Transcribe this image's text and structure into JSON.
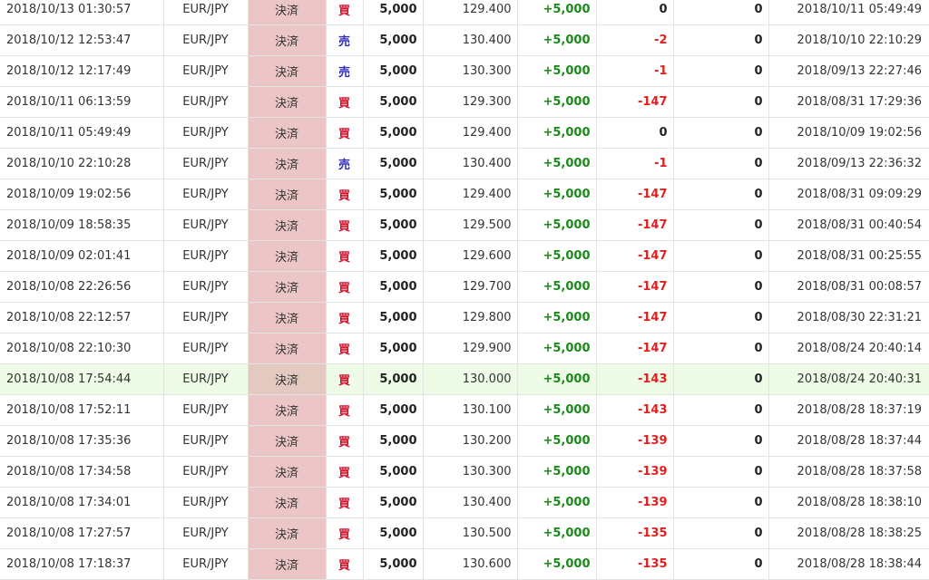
{
  "colors": {
    "type_cell_bg": "#ecc6c6",
    "highlight_row_bg": "#eefbe6",
    "positive": "#1a8a1a",
    "negative": "#e0201e",
    "buy": "#d0142c",
    "sell": "#2a2ab8"
  },
  "highlighted_row_index": 12,
  "rows": [
    {
      "close_time": "2018/10/13 01:30:57",
      "pair": "EUR/JPY",
      "type": "決済",
      "side": "買",
      "lots": "5,000",
      "rate": "129.400",
      "pnl": "+5,000",
      "swap": "0",
      "fee": "0",
      "open_time": "2018/10/11 05:49:49"
    },
    {
      "close_time": "2018/10/12 12:53:47",
      "pair": "EUR/JPY",
      "type": "決済",
      "side": "売",
      "lots": "5,000",
      "rate": "130.400",
      "pnl": "+5,000",
      "swap": "-2",
      "fee": "0",
      "open_time": "2018/10/10 22:10:29"
    },
    {
      "close_time": "2018/10/12 12:17:49",
      "pair": "EUR/JPY",
      "type": "決済",
      "side": "売",
      "lots": "5,000",
      "rate": "130.300",
      "pnl": "+5,000",
      "swap": "-1",
      "fee": "0",
      "open_time": "2018/09/13 22:27:46"
    },
    {
      "close_time": "2018/10/11 06:13:59",
      "pair": "EUR/JPY",
      "type": "決済",
      "side": "買",
      "lots": "5,000",
      "rate": "129.300",
      "pnl": "+5,000",
      "swap": "-147",
      "fee": "0",
      "open_time": "2018/08/31 17:29:36"
    },
    {
      "close_time": "2018/10/11 05:49:49",
      "pair": "EUR/JPY",
      "type": "決済",
      "side": "買",
      "lots": "5,000",
      "rate": "129.400",
      "pnl": "+5,000",
      "swap": "0",
      "fee": "0",
      "open_time": "2018/10/09 19:02:56"
    },
    {
      "close_time": "2018/10/10 22:10:28",
      "pair": "EUR/JPY",
      "type": "決済",
      "side": "売",
      "lots": "5,000",
      "rate": "130.400",
      "pnl": "+5,000",
      "swap": "-1",
      "fee": "0",
      "open_time": "2018/09/13 22:36:32"
    },
    {
      "close_time": "2018/10/09 19:02:56",
      "pair": "EUR/JPY",
      "type": "決済",
      "side": "買",
      "lots": "5,000",
      "rate": "129.400",
      "pnl": "+5,000",
      "swap": "-147",
      "fee": "0",
      "open_time": "2018/08/31 09:09:29"
    },
    {
      "close_time": "2018/10/09 18:58:35",
      "pair": "EUR/JPY",
      "type": "決済",
      "side": "買",
      "lots": "5,000",
      "rate": "129.500",
      "pnl": "+5,000",
      "swap": "-147",
      "fee": "0",
      "open_time": "2018/08/31 00:40:54"
    },
    {
      "close_time": "2018/10/09 02:01:41",
      "pair": "EUR/JPY",
      "type": "決済",
      "side": "買",
      "lots": "5,000",
      "rate": "129.600",
      "pnl": "+5,000",
      "swap": "-147",
      "fee": "0",
      "open_time": "2018/08/31 00:25:55"
    },
    {
      "close_time": "2018/10/08 22:26:56",
      "pair": "EUR/JPY",
      "type": "決済",
      "side": "買",
      "lots": "5,000",
      "rate": "129.700",
      "pnl": "+5,000",
      "swap": "-147",
      "fee": "0",
      "open_time": "2018/08/31 00:08:57"
    },
    {
      "close_time": "2018/10/08 22:12:57",
      "pair": "EUR/JPY",
      "type": "決済",
      "side": "買",
      "lots": "5,000",
      "rate": "129.800",
      "pnl": "+5,000",
      "swap": "-147",
      "fee": "0",
      "open_time": "2018/08/30 22:31:21"
    },
    {
      "close_time": "2018/10/08 22:10:30",
      "pair": "EUR/JPY",
      "type": "決済",
      "side": "買",
      "lots": "5,000",
      "rate": "129.900",
      "pnl": "+5,000",
      "swap": "-147",
      "fee": "0",
      "open_time": "2018/08/24 20:40:14"
    },
    {
      "close_time": "2018/10/08 17:54:44",
      "pair": "EUR/JPY",
      "type": "決済",
      "side": "買",
      "lots": "5,000",
      "rate": "130.000",
      "pnl": "+5,000",
      "swap": "-143",
      "fee": "0",
      "open_time": "2018/08/24 20:40:31"
    },
    {
      "close_time": "2018/10/08 17:52:11",
      "pair": "EUR/JPY",
      "type": "決済",
      "side": "買",
      "lots": "5,000",
      "rate": "130.100",
      "pnl": "+5,000",
      "swap": "-143",
      "fee": "0",
      "open_time": "2018/08/28 18:37:19"
    },
    {
      "close_time": "2018/10/08 17:35:36",
      "pair": "EUR/JPY",
      "type": "決済",
      "side": "買",
      "lots": "5,000",
      "rate": "130.200",
      "pnl": "+5,000",
      "swap": "-139",
      "fee": "0",
      "open_time": "2018/08/28 18:37:44"
    },
    {
      "close_time": "2018/10/08 17:34:58",
      "pair": "EUR/JPY",
      "type": "決済",
      "side": "買",
      "lots": "5,000",
      "rate": "130.300",
      "pnl": "+5,000",
      "swap": "-139",
      "fee": "0",
      "open_time": "2018/08/28 18:37:58"
    },
    {
      "close_time": "2018/10/08 17:34:01",
      "pair": "EUR/JPY",
      "type": "決済",
      "side": "買",
      "lots": "5,000",
      "rate": "130.400",
      "pnl": "+5,000",
      "swap": "-139",
      "fee": "0",
      "open_time": "2018/08/28 18:38:10"
    },
    {
      "close_time": "2018/10/08 17:27:57",
      "pair": "EUR/JPY",
      "type": "決済",
      "side": "買",
      "lots": "5,000",
      "rate": "130.500",
      "pnl": "+5,000",
      "swap": "-135",
      "fee": "0",
      "open_time": "2018/08/28 18:38:25"
    },
    {
      "close_time": "2018/10/08 17:18:37",
      "pair": "EUR/JPY",
      "type": "決済",
      "side": "買",
      "lots": "5,000",
      "rate": "130.600",
      "pnl": "+5,000",
      "swap": "-135",
      "fee": "0",
      "open_time": "2018/08/28 18:38:44"
    }
  ]
}
